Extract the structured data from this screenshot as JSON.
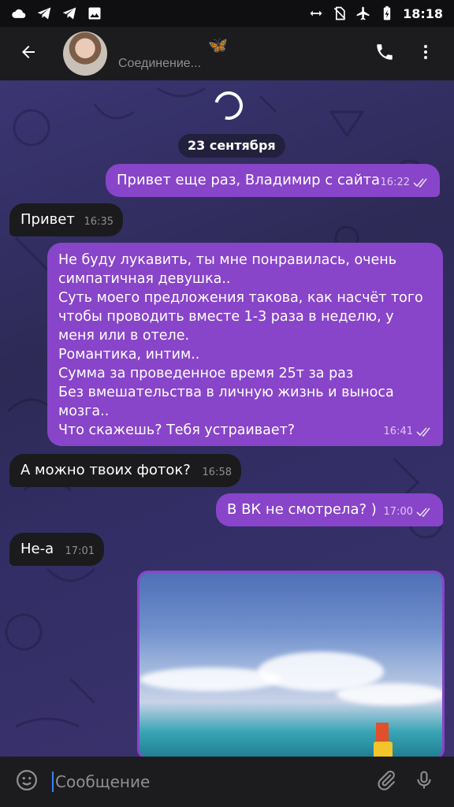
{
  "status_bar": {
    "time": "18:18",
    "left_icons": [
      "cloud-icon",
      "telegram-icon",
      "telegram-icon",
      "image-icon"
    ],
    "right_icons": [
      "data-saver-icon",
      "no-sim-icon",
      "airplane-icon",
      "battery-charging-icon"
    ]
  },
  "header": {
    "back_icon": "back-arrow-icon",
    "contact_name": "ᅠᅠᅠᅠᅠᅠ",
    "name_emoji": "🦋",
    "status": "Соединение...",
    "call_icon": "phone-icon",
    "menu_icon": "more-vertical-icon"
  },
  "chat": {
    "date_separator": "23 сентября",
    "messages": [
      {
        "direction": "out",
        "text": "Привет еще раз, Владимир с сайта",
        "time": "16:22"
      },
      {
        "direction": "in",
        "text": "Привет",
        "time": "16:35"
      },
      {
        "direction": "out",
        "text": "Не буду лукавить, ты мне понравилась, очень\nсимпатичная девушка..\nСуть моего предложения такова, как насчёт того\nчтобы проводить вместе 1-3 раза в неделю, у\nменя или в отеле.\nРомантика, интим..\nСумма за проведенное время 25т за раз\nБез вмешательства в личную жизнь и выноса\nмозга..\nЧто скажешь? Тебя устраивает?",
        "time": "16:41"
      },
      {
        "direction": "in",
        "text": "А можно твоих фоток?",
        "time": "16:58"
      },
      {
        "direction": "out",
        "text": "В ВК не смотрела? )",
        "time": "17:00"
      },
      {
        "direction": "in",
        "text": "Не-а",
        "time": "17:01"
      }
    ],
    "photo_message": {
      "description_icon": "photo-attachment"
    }
  },
  "input_bar": {
    "placeholder": "Сообщение",
    "emoji_icon": "emoji-icon",
    "attach_icon": "paperclip-icon",
    "mic_icon": "microphone-icon"
  },
  "colors": {
    "outgoing_bubble": "#8845c9",
    "incoming_bubble": "#1b1b1d",
    "header_bg": "#1c1c1e",
    "accent": "#3b82f6"
  }
}
